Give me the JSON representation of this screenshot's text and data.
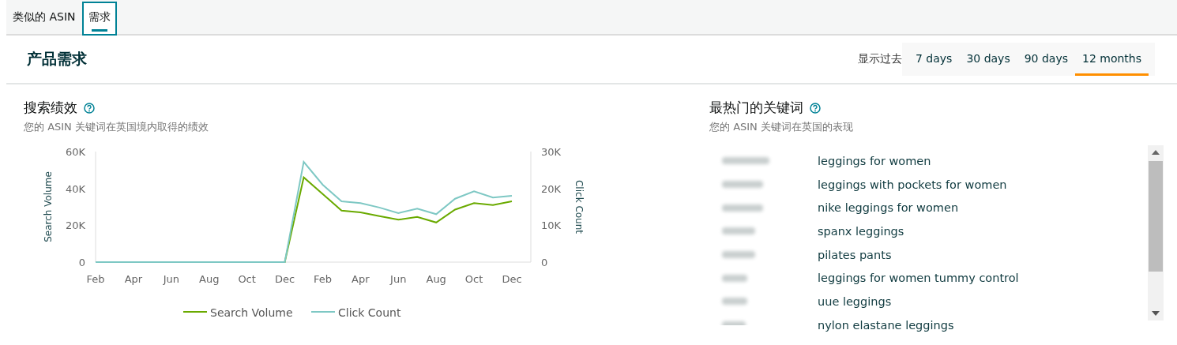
{
  "tabs": [
    {
      "label": "类似的 ASIN",
      "selected": false
    },
    {
      "label": "需求",
      "selected": true
    }
  ],
  "header": {
    "title": "产品需求",
    "range_label": "显示过去",
    "ranges": [
      {
        "label": "7 days",
        "selected": false
      },
      {
        "label": "30 days",
        "selected": false
      },
      {
        "label": "90 days",
        "selected": false
      },
      {
        "label": "12 months",
        "selected": true
      }
    ]
  },
  "search_performance": {
    "title": "搜索绩效",
    "subtitle": "您的 ASIN 关键词在英国境内取得的绩效",
    "chart_data": {
      "type": "line",
      "ylabel": "Search Volume",
      "y2label": "Click Count",
      "categories": [
        "Feb",
        null,
        "Apr",
        null,
        "Jun",
        null,
        "Aug",
        null,
        "Oct",
        null,
        "Dec",
        null,
        "Feb",
        null,
        "Apr",
        null,
        "Jun",
        null,
        "Aug",
        null,
        "Oct",
        null,
        "Dec"
      ],
      "legend": true,
      "ylim": [
        0,
        60000
      ],
      "yticks": [
        {
          "value": 0,
          "label": "0"
        },
        {
          "value": 20000,
          "label": "20K"
        },
        {
          "value": 40000,
          "label": "40K"
        },
        {
          "value": 60000,
          "label": "60K"
        }
      ],
      "y2lim": [
        0,
        30000
      ],
      "y2ticks": [
        {
          "value": 0,
          "label": "0"
        },
        {
          "value": 10000,
          "label": "10K"
        },
        {
          "value": 20000,
          "label": "20K"
        },
        {
          "value": 30000,
          "label": "30K"
        }
      ],
      "series": [
        {
          "name": "Search Volume",
          "color": "#6aaa00",
          "values": [
            null,
            null,
            null,
            null,
            null,
            null,
            null,
            null,
            null,
            0,
            0,
            46000,
            37000,
            28000,
            27000,
            25000,
            23000,
            24500,
            21500,
            28500,
            32000,
            31000,
            33000
          ]
        },
        {
          "name": "Click Count",
          "color": "#7ec8c4",
          "axis": "y2",
          "values": [
            0,
            0,
            0,
            0,
            0,
            0,
            0,
            0,
            0,
            0,
            0,
            27200,
            21000,
            16500,
            16000,
            14800,
            13300,
            14500,
            13000,
            17200,
            19200,
            17500,
            18000
          ]
        }
      ]
    }
  },
  "top_keywords": {
    "title": "最热门的关键词",
    "subtitle": "您的 ASIN 关键词在英国的表现",
    "rows": [
      {
        "keyword": "leggings for women"
      },
      {
        "keyword": "leggings with pockets for women"
      },
      {
        "keyword": "nike leggings for women"
      },
      {
        "keyword": "spanx leggings"
      },
      {
        "keyword": "pilates pants"
      },
      {
        "keyword": "leggings for women tummy control"
      },
      {
        "keyword": "uue leggings"
      },
      {
        "keyword": "nylon elastane leggings"
      }
    ]
  }
}
